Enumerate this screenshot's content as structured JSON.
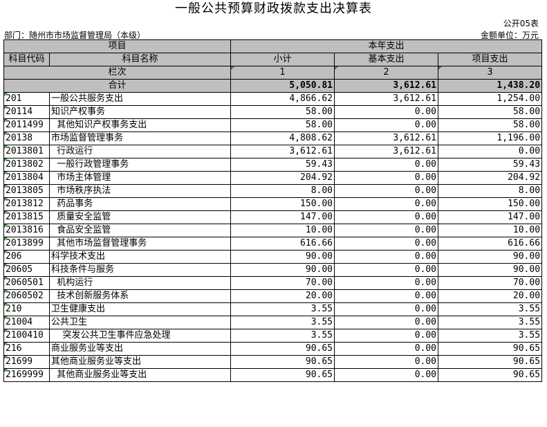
{
  "title": "一般公共预算财政拨款支出决算表",
  "form_code": "公开05表",
  "department": "部门：随州市市场监督管理局（本级）",
  "unit": "金额单位：万元",
  "header": {
    "project": "项目",
    "current_year": "本年支出",
    "subject_code": "科目代码",
    "subject_name": "科目名称",
    "subtotal": "小计",
    "basic": "基本支出",
    "project_exp": "项目支出",
    "column_index": "栏次",
    "col1": "1",
    "col2": "2",
    "col3": "3"
  },
  "total": {
    "label": "合计",
    "subtotal": "5,050.81",
    "basic": "3,612.61",
    "project": "1,438.20"
  },
  "rows": [
    {
      "code": "201",
      "name": "一般公共服务支出",
      "subtotal": "4,866.62",
      "basic": "3,612.61",
      "project": "1,254.00"
    },
    {
      "code": "20114",
      "name": "知识产权事务",
      "subtotal": "58.00",
      "basic": "0.00",
      "project": "58.00"
    },
    {
      "code": "2011499",
      "name": "  其他知识产权事务支出",
      "subtotal": "58.00",
      "basic": "0.00",
      "project": "58.00"
    },
    {
      "code": "20138",
      "name": "市场监督管理事务",
      "subtotal": "4,808.62",
      "basic": "3,612.61",
      "project": "1,196.00"
    },
    {
      "code": "2013801",
      "name": "  行政运行",
      "subtotal": "3,612.61",
      "basic": "3,612.61",
      "project": "0.00"
    },
    {
      "code": "2013802",
      "name": "  一般行政管理事务",
      "subtotal": "59.43",
      "basic": "0.00",
      "project": "59.43"
    },
    {
      "code": "2013804",
      "name": "  市场主体管理",
      "subtotal": "204.92",
      "basic": "0.00",
      "project": "204.92"
    },
    {
      "code": "2013805",
      "name": "  市场秩序执法",
      "subtotal": "8.00",
      "basic": "0.00",
      "project": "8.00"
    },
    {
      "code": "2013812",
      "name": "  药品事务",
      "subtotal": "150.00",
      "basic": "0.00",
      "project": "150.00"
    },
    {
      "code": "2013815",
      "name": "  质量安全监管",
      "subtotal": "147.00",
      "basic": "0.00",
      "project": "147.00"
    },
    {
      "code": "2013816",
      "name": "  食品安全监管",
      "subtotal": "10.00",
      "basic": "0.00",
      "project": "10.00"
    },
    {
      "code": "2013899",
      "name": "  其他市场监督管理事务",
      "subtotal": "616.66",
      "basic": "0.00",
      "project": "616.66"
    },
    {
      "code": "206",
      "name": "科学技术支出",
      "subtotal": "90.00",
      "basic": "0.00",
      "project": "90.00"
    },
    {
      "code": "20605",
      "name": "科技条件与服务",
      "subtotal": "90.00",
      "basic": "0.00",
      "project": "90.00"
    },
    {
      "code": "2060501",
      "name": "  机构运行",
      "subtotal": "70.00",
      "basic": "0.00",
      "project": "70.00"
    },
    {
      "code": "2060502",
      "name": "  技术创新服务体系",
      "subtotal": "20.00",
      "basic": "0.00",
      "project": "20.00"
    },
    {
      "code": "210",
      "name": "卫生健康支出",
      "subtotal": "3.55",
      "basic": "0.00",
      "project": "3.55"
    },
    {
      "code": "21004",
      "name": "公共卫生",
      "subtotal": "3.55",
      "basic": "0.00",
      "project": "3.55"
    },
    {
      "code": "2100410",
      "name": "    突发公共卫生事件应急处理",
      "subtotal": "3.55",
      "basic": "0.00",
      "project": "3.55"
    },
    {
      "code": "216",
      "name": "商业服务业等支出",
      "subtotal": "90.65",
      "basic": "0.00",
      "project": "90.65"
    },
    {
      "code": "21699",
      "name": "其他商业服务业等支出",
      "subtotal": "90.65",
      "basic": "0.00",
      "project": "90.65"
    },
    {
      "code": "2169999",
      "name": "  其他商业服务业等支出",
      "subtotal": "90.65",
      "basic": "0.00",
      "project": "90.65"
    }
  ]
}
